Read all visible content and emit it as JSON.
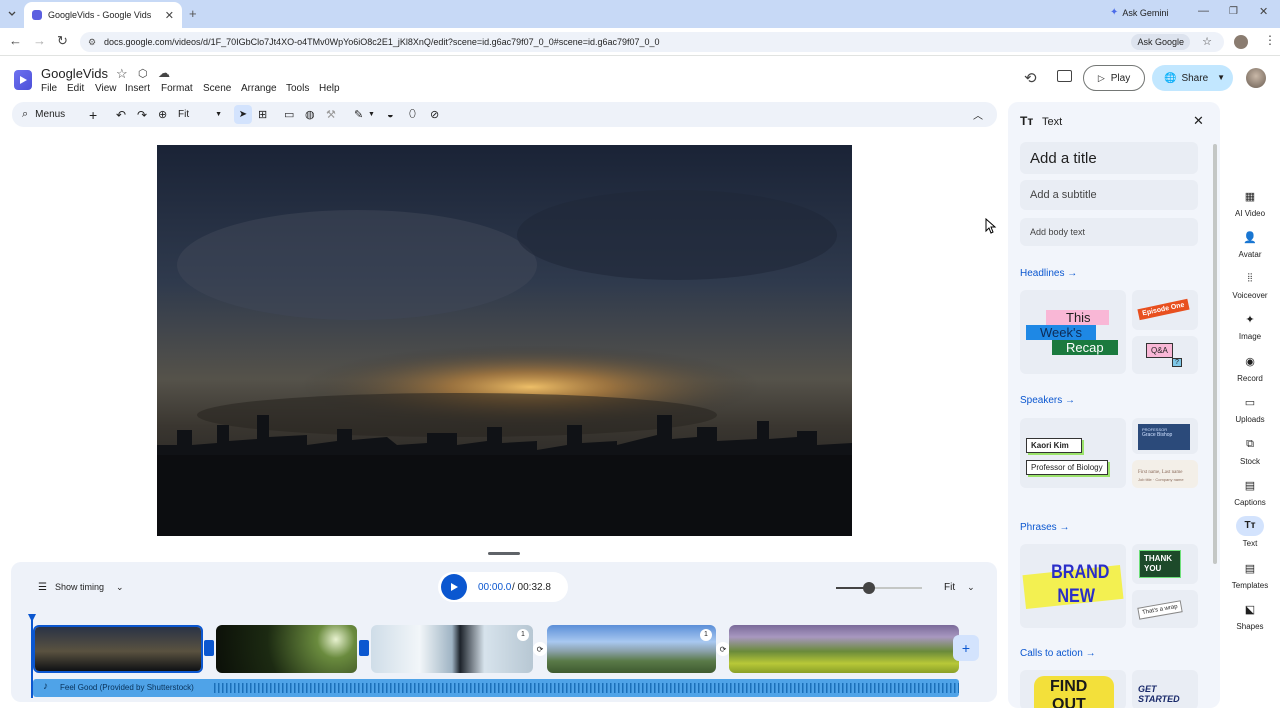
{
  "browser": {
    "tab_title": "GoogleVids - Google Vids",
    "ask_gemini": "Ask Gemini",
    "url": "docs.google.com/videos/d/1F_70IGbClo7Jt4XO-o4TMv0WpYo6iO8c2E1_jKl8XnQ/edit?scene=id.g6ac79f07_0_0#scene=id.g6ac79f07_0_0",
    "ask_google": "Ask Google"
  },
  "app": {
    "doc_name": "GoogleVids",
    "menus": [
      "File",
      "Edit",
      "View",
      "Insert",
      "Format",
      "Scene",
      "Arrange",
      "Tools",
      "Help"
    ],
    "play_label": "Play",
    "share_label": "Share"
  },
  "toolbar": {
    "menus_label": "Menus",
    "zoom_label": "Fit"
  },
  "timeline": {
    "show_timing": "Show timing",
    "current_time": "00:00.0",
    "total_time": "/ 00:32.8",
    "fit_label": "Fit",
    "audio_label": "Feel Good (Provided by Shutterstock)",
    "clip_badge_3": "1",
    "clip_badge_4": "1"
  },
  "text_panel": {
    "title": "Text",
    "add_title": "Add a title",
    "add_subtitle": "Add a subtitle",
    "add_body": "Add body text",
    "sections": {
      "headlines": "Headlines",
      "speakers": "Speakers",
      "phrases": "Phrases",
      "calls": "Calls to action"
    },
    "samples": {
      "recap_1": "This",
      "recap_2": "Week's",
      "recap_3": "Recap",
      "episode": "Episode One",
      "qa": "Q&A",
      "qa_q": "?",
      "speaker_name": "Kaori Kim",
      "speaker_title": "Professor of Biology",
      "prof_small": "PROFESSOR",
      "prof_name": "Grace Bishop",
      "first_last": "First name, Last name",
      "first_last_sub": "Job title · Company name",
      "brand_1": "BRAND",
      "brand_2": "NEW",
      "thank_1": "THANK",
      "thank_2": "YOU",
      "wrap": "That's a wrap",
      "find_1": "FIND",
      "find_2": "OUT",
      "get_started": "GET STARTED"
    }
  },
  "rail": [
    {
      "label": "AI Video",
      "icon": "ai-video-icon"
    },
    {
      "label": "Avatar",
      "icon": "avatar-icon"
    },
    {
      "label": "Voiceover",
      "icon": "voiceover-icon"
    },
    {
      "label": "Image",
      "icon": "image-icon"
    },
    {
      "label": "Record",
      "icon": "record-icon"
    },
    {
      "label": "Uploads",
      "icon": "uploads-icon"
    },
    {
      "label": "Stock",
      "icon": "stock-icon"
    },
    {
      "label": "Captions",
      "icon": "captions-icon"
    },
    {
      "label": "Text",
      "icon": "text-icon"
    },
    {
      "label": "Templates",
      "icon": "templates-icon"
    },
    {
      "label": "Shapes",
      "icon": "shapes-icon"
    }
  ],
  "colors": {
    "accent": "#0b57d0",
    "play_button": "#0b57d0",
    "audio_track": "#4fa3e8",
    "share_bg": "#c2e7ff"
  }
}
